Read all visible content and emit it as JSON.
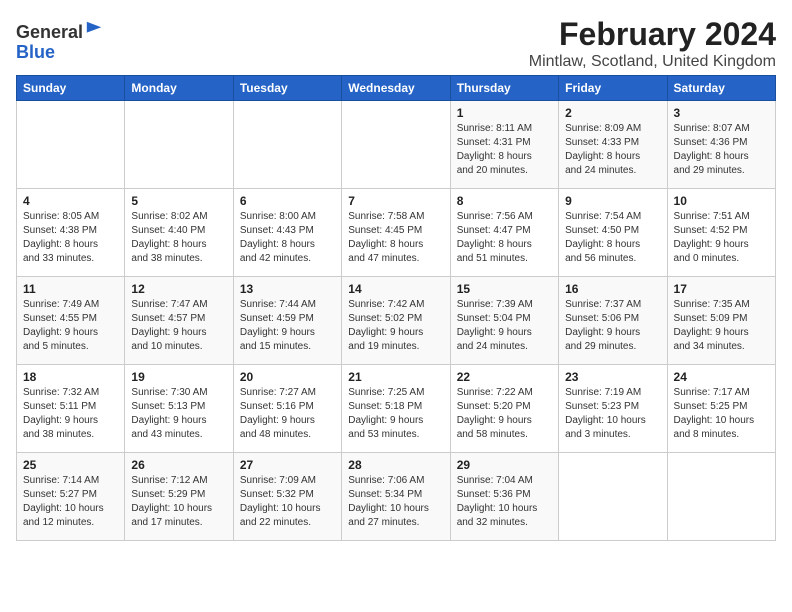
{
  "header": {
    "logo_line1": "General",
    "logo_line2": "Blue",
    "title": "February 2024",
    "subtitle": "Mintlaw, Scotland, United Kingdom"
  },
  "days_of_week": [
    "Sunday",
    "Monday",
    "Tuesday",
    "Wednesday",
    "Thursday",
    "Friday",
    "Saturday"
  ],
  "weeks": [
    [
      {
        "day": "",
        "info": ""
      },
      {
        "day": "",
        "info": ""
      },
      {
        "day": "",
        "info": ""
      },
      {
        "day": "",
        "info": ""
      },
      {
        "day": "1",
        "info": "Sunrise: 8:11 AM\nSunset: 4:31 PM\nDaylight: 8 hours\nand 20 minutes."
      },
      {
        "day": "2",
        "info": "Sunrise: 8:09 AM\nSunset: 4:33 PM\nDaylight: 8 hours\nand 24 minutes."
      },
      {
        "day": "3",
        "info": "Sunrise: 8:07 AM\nSunset: 4:36 PM\nDaylight: 8 hours\nand 29 minutes."
      }
    ],
    [
      {
        "day": "4",
        "info": "Sunrise: 8:05 AM\nSunset: 4:38 PM\nDaylight: 8 hours\nand 33 minutes."
      },
      {
        "day": "5",
        "info": "Sunrise: 8:02 AM\nSunset: 4:40 PM\nDaylight: 8 hours\nand 38 minutes."
      },
      {
        "day": "6",
        "info": "Sunrise: 8:00 AM\nSunset: 4:43 PM\nDaylight: 8 hours\nand 42 minutes."
      },
      {
        "day": "7",
        "info": "Sunrise: 7:58 AM\nSunset: 4:45 PM\nDaylight: 8 hours\nand 47 minutes."
      },
      {
        "day": "8",
        "info": "Sunrise: 7:56 AM\nSunset: 4:47 PM\nDaylight: 8 hours\nand 51 minutes."
      },
      {
        "day": "9",
        "info": "Sunrise: 7:54 AM\nSunset: 4:50 PM\nDaylight: 8 hours\nand 56 minutes."
      },
      {
        "day": "10",
        "info": "Sunrise: 7:51 AM\nSunset: 4:52 PM\nDaylight: 9 hours\nand 0 minutes."
      }
    ],
    [
      {
        "day": "11",
        "info": "Sunrise: 7:49 AM\nSunset: 4:55 PM\nDaylight: 9 hours\nand 5 minutes."
      },
      {
        "day": "12",
        "info": "Sunrise: 7:47 AM\nSunset: 4:57 PM\nDaylight: 9 hours\nand 10 minutes."
      },
      {
        "day": "13",
        "info": "Sunrise: 7:44 AM\nSunset: 4:59 PM\nDaylight: 9 hours\nand 15 minutes."
      },
      {
        "day": "14",
        "info": "Sunrise: 7:42 AM\nSunset: 5:02 PM\nDaylight: 9 hours\nand 19 minutes."
      },
      {
        "day": "15",
        "info": "Sunrise: 7:39 AM\nSunset: 5:04 PM\nDaylight: 9 hours\nand 24 minutes."
      },
      {
        "day": "16",
        "info": "Sunrise: 7:37 AM\nSunset: 5:06 PM\nDaylight: 9 hours\nand 29 minutes."
      },
      {
        "day": "17",
        "info": "Sunrise: 7:35 AM\nSunset: 5:09 PM\nDaylight: 9 hours\nand 34 minutes."
      }
    ],
    [
      {
        "day": "18",
        "info": "Sunrise: 7:32 AM\nSunset: 5:11 PM\nDaylight: 9 hours\nand 38 minutes."
      },
      {
        "day": "19",
        "info": "Sunrise: 7:30 AM\nSunset: 5:13 PM\nDaylight: 9 hours\nand 43 minutes."
      },
      {
        "day": "20",
        "info": "Sunrise: 7:27 AM\nSunset: 5:16 PM\nDaylight: 9 hours\nand 48 minutes."
      },
      {
        "day": "21",
        "info": "Sunrise: 7:25 AM\nSunset: 5:18 PM\nDaylight: 9 hours\nand 53 minutes."
      },
      {
        "day": "22",
        "info": "Sunrise: 7:22 AM\nSunset: 5:20 PM\nDaylight: 9 hours\nand 58 minutes."
      },
      {
        "day": "23",
        "info": "Sunrise: 7:19 AM\nSunset: 5:23 PM\nDaylight: 10 hours\nand 3 minutes."
      },
      {
        "day": "24",
        "info": "Sunrise: 7:17 AM\nSunset: 5:25 PM\nDaylight: 10 hours\nand 8 minutes."
      }
    ],
    [
      {
        "day": "25",
        "info": "Sunrise: 7:14 AM\nSunset: 5:27 PM\nDaylight: 10 hours\nand 12 minutes."
      },
      {
        "day": "26",
        "info": "Sunrise: 7:12 AM\nSunset: 5:29 PM\nDaylight: 10 hours\nand 17 minutes."
      },
      {
        "day": "27",
        "info": "Sunrise: 7:09 AM\nSunset: 5:32 PM\nDaylight: 10 hours\nand 22 minutes."
      },
      {
        "day": "28",
        "info": "Sunrise: 7:06 AM\nSunset: 5:34 PM\nDaylight: 10 hours\nand 27 minutes."
      },
      {
        "day": "29",
        "info": "Sunrise: 7:04 AM\nSunset: 5:36 PM\nDaylight: 10 hours\nand 32 minutes."
      },
      {
        "day": "",
        "info": ""
      },
      {
        "day": "",
        "info": ""
      }
    ]
  ]
}
